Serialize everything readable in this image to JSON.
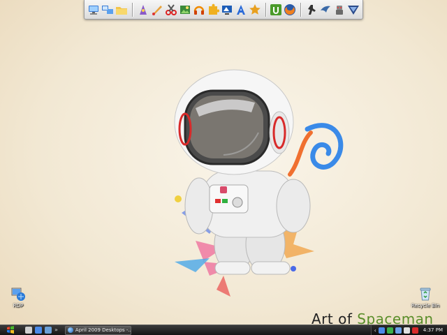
{
  "dock": {
    "groups": [
      [
        "computer-icon",
        "network-icon",
        "folder-icon"
      ],
      [
        "wizard-icon",
        "paint-icon",
        "scissors-icon",
        "picture-icon",
        "headphones-icon",
        "puzzle-icon",
        "monitor-icon",
        "font-icon",
        "star-icon"
      ],
      [
        "utorrent-icon",
        "firefox-icon"
      ],
      [
        "counter-strike-icon",
        "wing-icon",
        "robot-icon",
        "shield-logo-icon"
      ]
    ]
  },
  "wallpaper": {
    "brand_prefix": "Art of ",
    "brand_accent": "Spaceman"
  },
  "desktop_icons": {
    "rdp_label": "RDP",
    "recycle_label": "Recycle Bin"
  },
  "taskbar": {
    "task_label": "April 2009 Desktops -...",
    "clock": "4:37 PM",
    "quicklaunch_more": "»",
    "tray_arrow": "‹"
  },
  "colors": {
    "taskbar": "#1e1e1e",
    "accent_green": "#5a8e2a",
    "wallpaper": "#f5ecd9"
  }
}
